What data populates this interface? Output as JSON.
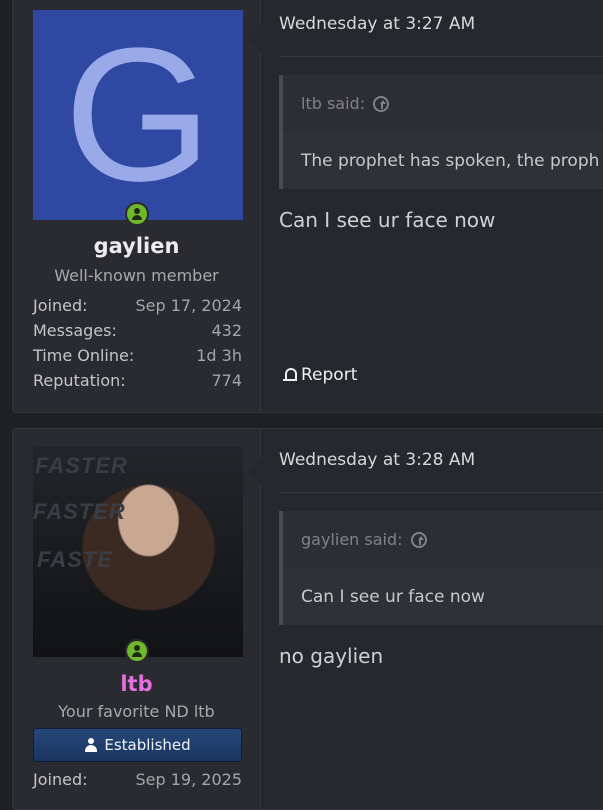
{
  "posts": [
    {
      "user": {
        "avatar_letter": "G",
        "avatar_color": "#2f49a3",
        "name": "gaylien",
        "title": "Well-known member",
        "stats": [
          {
            "label": "Joined:",
            "value": "Sep 17, 2024"
          },
          {
            "label": "Messages:",
            "value": "432"
          },
          {
            "label": "Time Online:",
            "value": "1d 3h"
          },
          {
            "label": "Reputation:",
            "value": "774"
          }
        ]
      },
      "date": "Wednesday at 3:27 AM",
      "quote": {
        "author": "ltb said:",
        "text": "The prophet has spoken, the proph"
      },
      "message": "Can I see ur face now",
      "report_label": "Report"
    },
    {
      "user": {
        "avatar_text": [
          "FASTER",
          "FASTER",
          "FASTE"
        ],
        "name": "ltb",
        "name_color": "#e46fe0",
        "title": "Your favorite ND ltb",
        "badge": "Established",
        "stats": [
          {
            "label": "Joined:",
            "value": "Sep 19, 2025"
          }
        ]
      },
      "date": "Wednesday at 3:28 AM",
      "quote": {
        "author": "gaylien said:",
        "text": "Can I see ur face now"
      },
      "message": "no gaylien"
    }
  ]
}
